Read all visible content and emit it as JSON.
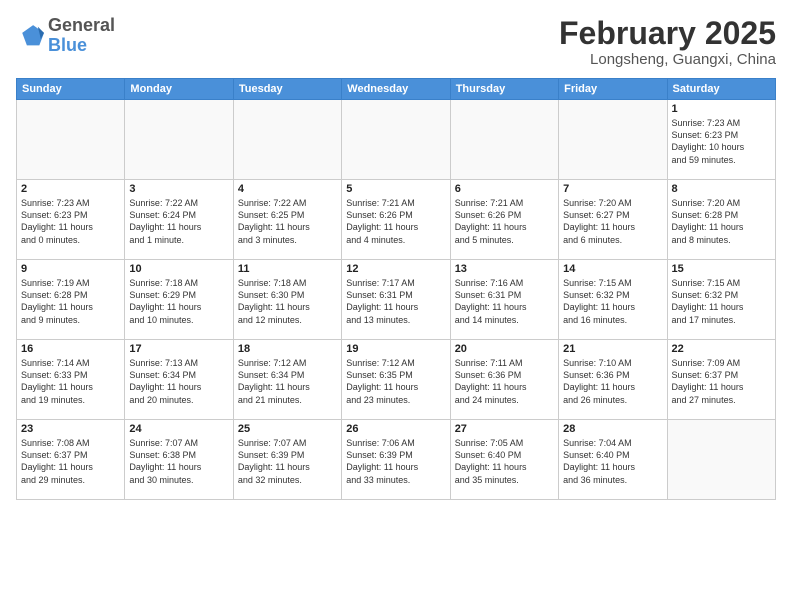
{
  "header": {
    "logo_line1": "General",
    "logo_line2": "Blue",
    "month_title": "February 2025",
    "location": "Longsheng, Guangxi, China"
  },
  "weekdays": [
    "Sunday",
    "Monday",
    "Tuesday",
    "Wednesday",
    "Thursday",
    "Friday",
    "Saturday"
  ],
  "weeks": [
    [
      {
        "day": "",
        "info": ""
      },
      {
        "day": "",
        "info": ""
      },
      {
        "day": "",
        "info": ""
      },
      {
        "day": "",
        "info": ""
      },
      {
        "day": "",
        "info": ""
      },
      {
        "day": "",
        "info": ""
      },
      {
        "day": "1",
        "info": "Sunrise: 7:23 AM\nSunset: 6:23 PM\nDaylight: 10 hours\nand 59 minutes."
      }
    ],
    [
      {
        "day": "2",
        "info": "Sunrise: 7:23 AM\nSunset: 6:23 PM\nDaylight: 11 hours\nand 0 minutes."
      },
      {
        "day": "3",
        "info": "Sunrise: 7:22 AM\nSunset: 6:24 PM\nDaylight: 11 hours\nand 1 minute."
      },
      {
        "day": "4",
        "info": "Sunrise: 7:22 AM\nSunset: 6:25 PM\nDaylight: 11 hours\nand 3 minutes."
      },
      {
        "day": "5",
        "info": "Sunrise: 7:21 AM\nSunset: 6:26 PM\nDaylight: 11 hours\nand 4 minutes."
      },
      {
        "day": "6",
        "info": "Sunrise: 7:21 AM\nSunset: 6:26 PM\nDaylight: 11 hours\nand 5 minutes."
      },
      {
        "day": "7",
        "info": "Sunrise: 7:20 AM\nSunset: 6:27 PM\nDaylight: 11 hours\nand 6 minutes."
      },
      {
        "day": "8",
        "info": "Sunrise: 7:20 AM\nSunset: 6:28 PM\nDaylight: 11 hours\nand 8 minutes."
      }
    ],
    [
      {
        "day": "9",
        "info": "Sunrise: 7:19 AM\nSunset: 6:28 PM\nDaylight: 11 hours\nand 9 minutes."
      },
      {
        "day": "10",
        "info": "Sunrise: 7:18 AM\nSunset: 6:29 PM\nDaylight: 11 hours\nand 10 minutes."
      },
      {
        "day": "11",
        "info": "Sunrise: 7:18 AM\nSunset: 6:30 PM\nDaylight: 11 hours\nand 12 minutes."
      },
      {
        "day": "12",
        "info": "Sunrise: 7:17 AM\nSunset: 6:31 PM\nDaylight: 11 hours\nand 13 minutes."
      },
      {
        "day": "13",
        "info": "Sunrise: 7:16 AM\nSunset: 6:31 PM\nDaylight: 11 hours\nand 14 minutes."
      },
      {
        "day": "14",
        "info": "Sunrise: 7:15 AM\nSunset: 6:32 PM\nDaylight: 11 hours\nand 16 minutes."
      },
      {
        "day": "15",
        "info": "Sunrise: 7:15 AM\nSunset: 6:32 PM\nDaylight: 11 hours\nand 17 minutes."
      }
    ],
    [
      {
        "day": "16",
        "info": "Sunrise: 7:14 AM\nSunset: 6:33 PM\nDaylight: 11 hours\nand 19 minutes."
      },
      {
        "day": "17",
        "info": "Sunrise: 7:13 AM\nSunset: 6:34 PM\nDaylight: 11 hours\nand 20 minutes."
      },
      {
        "day": "18",
        "info": "Sunrise: 7:12 AM\nSunset: 6:34 PM\nDaylight: 11 hours\nand 21 minutes."
      },
      {
        "day": "19",
        "info": "Sunrise: 7:12 AM\nSunset: 6:35 PM\nDaylight: 11 hours\nand 23 minutes."
      },
      {
        "day": "20",
        "info": "Sunrise: 7:11 AM\nSunset: 6:36 PM\nDaylight: 11 hours\nand 24 minutes."
      },
      {
        "day": "21",
        "info": "Sunrise: 7:10 AM\nSunset: 6:36 PM\nDaylight: 11 hours\nand 26 minutes."
      },
      {
        "day": "22",
        "info": "Sunrise: 7:09 AM\nSunset: 6:37 PM\nDaylight: 11 hours\nand 27 minutes."
      }
    ],
    [
      {
        "day": "23",
        "info": "Sunrise: 7:08 AM\nSunset: 6:37 PM\nDaylight: 11 hours\nand 29 minutes."
      },
      {
        "day": "24",
        "info": "Sunrise: 7:07 AM\nSunset: 6:38 PM\nDaylight: 11 hours\nand 30 minutes."
      },
      {
        "day": "25",
        "info": "Sunrise: 7:07 AM\nSunset: 6:39 PM\nDaylight: 11 hours\nand 32 minutes."
      },
      {
        "day": "26",
        "info": "Sunrise: 7:06 AM\nSunset: 6:39 PM\nDaylight: 11 hours\nand 33 minutes."
      },
      {
        "day": "27",
        "info": "Sunrise: 7:05 AM\nSunset: 6:40 PM\nDaylight: 11 hours\nand 35 minutes."
      },
      {
        "day": "28",
        "info": "Sunrise: 7:04 AM\nSunset: 6:40 PM\nDaylight: 11 hours\nand 36 minutes."
      },
      {
        "day": "",
        "info": ""
      }
    ]
  ]
}
